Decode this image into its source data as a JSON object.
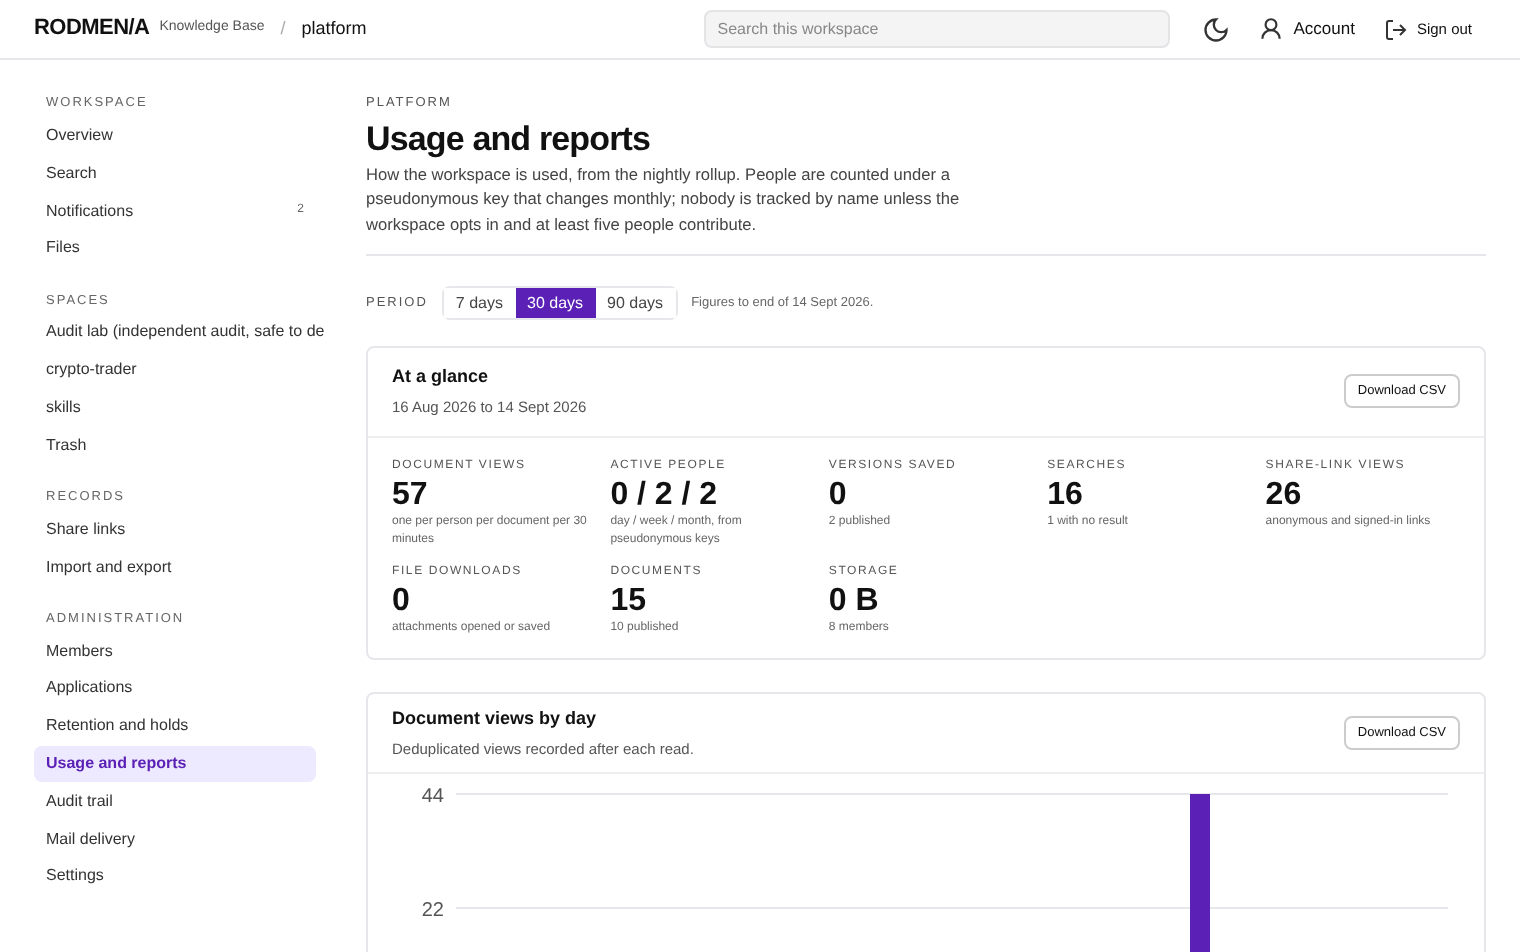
{
  "header": {
    "brand": "RODMEN/A",
    "product": "Knowledge Base",
    "separator": "/",
    "workspace": "platform",
    "search": {
      "placeholder": "Search this workspace"
    },
    "account": "Account",
    "sign_out": "Sign out"
  },
  "sidebar": {
    "sections": [
      {
        "title": "WORKSPACE",
        "items": [
          {
            "label": "Overview",
            "selected": false
          },
          {
            "label": "Search",
            "selected": false
          },
          {
            "label": "Notifications",
            "badge": "2",
            "selected": false
          },
          {
            "label": "Files",
            "selected": false
          }
        ]
      },
      {
        "title": "SPACES",
        "items": [
          {
            "label": "Audit lab (independent audit, safe to de",
            "selected": false
          },
          {
            "label": "crypto-trader",
            "selected": false
          },
          {
            "label": "skills",
            "selected": false
          },
          {
            "label": "Trash",
            "selected": false
          }
        ]
      },
      {
        "title": "RECORDS",
        "items": [
          {
            "label": "Share links",
            "selected": false
          },
          {
            "label": "Import and export",
            "selected": false
          }
        ]
      },
      {
        "title": "ADMINISTRATION",
        "items": [
          {
            "label": "Members",
            "selected": false
          },
          {
            "label": "Applications",
            "selected": false
          },
          {
            "label": "Retention and holds",
            "selected": false
          },
          {
            "label": "Usage and reports",
            "selected": true
          },
          {
            "label": "Audit trail",
            "selected": false
          },
          {
            "label": "Mail delivery",
            "selected": false
          },
          {
            "label": "Settings",
            "selected": false
          }
        ]
      }
    ]
  },
  "page": {
    "eyebrow": "PLATFORM",
    "title": "Usage and reports",
    "description": "How the workspace is used, from the nightly rollup. People are counted under a pseudonymous key that changes monthly; nobody is tracked by name unless the workspace opts in and at least five people contribute."
  },
  "period": {
    "label": "PERIOD",
    "options": [
      {
        "label": "7 days",
        "selected": false
      },
      {
        "label": "30 days",
        "selected": true
      },
      {
        "label": "90 days",
        "selected": false
      }
    ],
    "note": "Figures to end of 14 Sept 2026."
  },
  "glance": {
    "title": "At a glance",
    "subtitle": "16 Aug 2026 to 14 Sept 2026",
    "button": "Download CSV",
    "stats": [
      {
        "label": "DOCUMENT VIEWS",
        "value": "57",
        "note": "one per person per document per 30 minutes"
      },
      {
        "label": "ACTIVE PEOPLE",
        "value": "0 / 2 / 2",
        "note": "day / week / month, from pseudonymous keys"
      },
      {
        "label": "VERSIONS SAVED",
        "value": "0",
        "note": "2 published"
      },
      {
        "label": "SEARCHES",
        "value": "16",
        "note": "1 with no result"
      },
      {
        "label": "SHARE-LINK VIEWS",
        "value": "26",
        "note": "anonymous and signed-in links"
      },
      {
        "label": "FILE DOWNLOADS",
        "value": "0",
        "note": "attachments opened or saved"
      },
      {
        "label": "DOCUMENTS",
        "value": "15",
        "note": "10 published"
      },
      {
        "label": "STORAGE",
        "value": "0 B",
        "note": "8 members"
      }
    ]
  },
  "views_chart": {
    "title": "Document views by day",
    "subtitle": "Deduplicated views recorded after each read.",
    "button": "Download CSV",
    "chart_data": {
      "type": "bar",
      "ylim": [
        0,
        44
      ],
      "yticks": [
        22,
        44
      ],
      "series": [
        {
          "color": "#5b21b6",
          "values": [
            null,
            null,
            null,
            null,
            null,
            null,
            null,
            null,
            null,
            null,
            null,
            null,
            null,
            null,
            null,
            null,
            null,
            null,
            null,
            null,
            null,
            null,
            44,
            null,
            null,
            null,
            null,
            null,
            null,
            null
          ]
        }
      ]
    }
  }
}
